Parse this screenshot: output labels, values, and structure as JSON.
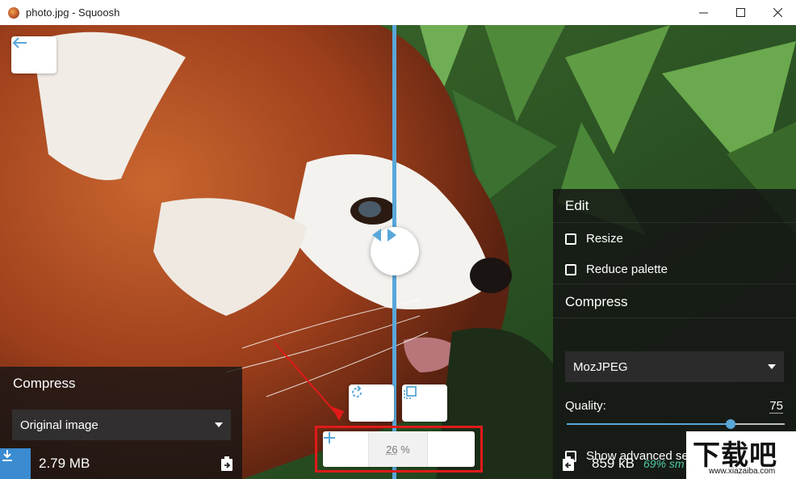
{
  "window": {
    "title": "photo.jpg - Squoosh",
    "controls": [
      "minimize-icon",
      "maximize-icon",
      "close-icon"
    ]
  },
  "left_panel": {
    "heading": "Compress",
    "selected_method": "Original image",
    "file_size": "2.79 MB"
  },
  "right_panel": {
    "edit_heading": "Edit",
    "options": [
      {
        "label": "Resize",
        "checked": false
      },
      {
        "label": "Reduce palette",
        "checked": false
      }
    ],
    "compress_heading": "Compress",
    "selected_codec": "MozJPEG",
    "quality_label": "Quality:",
    "quality_value": "75",
    "quality_fraction": 0.75,
    "advanced_label": "Show advanced settings",
    "advanced_checked": false,
    "output_size": "859 kB",
    "savings": "69% sm"
  },
  "zoom": {
    "value": "26",
    "unit": "%"
  },
  "watermark": {
    "text": "下载吧",
    "url": "www.xiazaiba.com"
  },
  "colors": {
    "accent": "#59a7d9",
    "download": "#3a8bd0",
    "savings": "#4ec9a6",
    "highlight": "#e01a1a"
  }
}
